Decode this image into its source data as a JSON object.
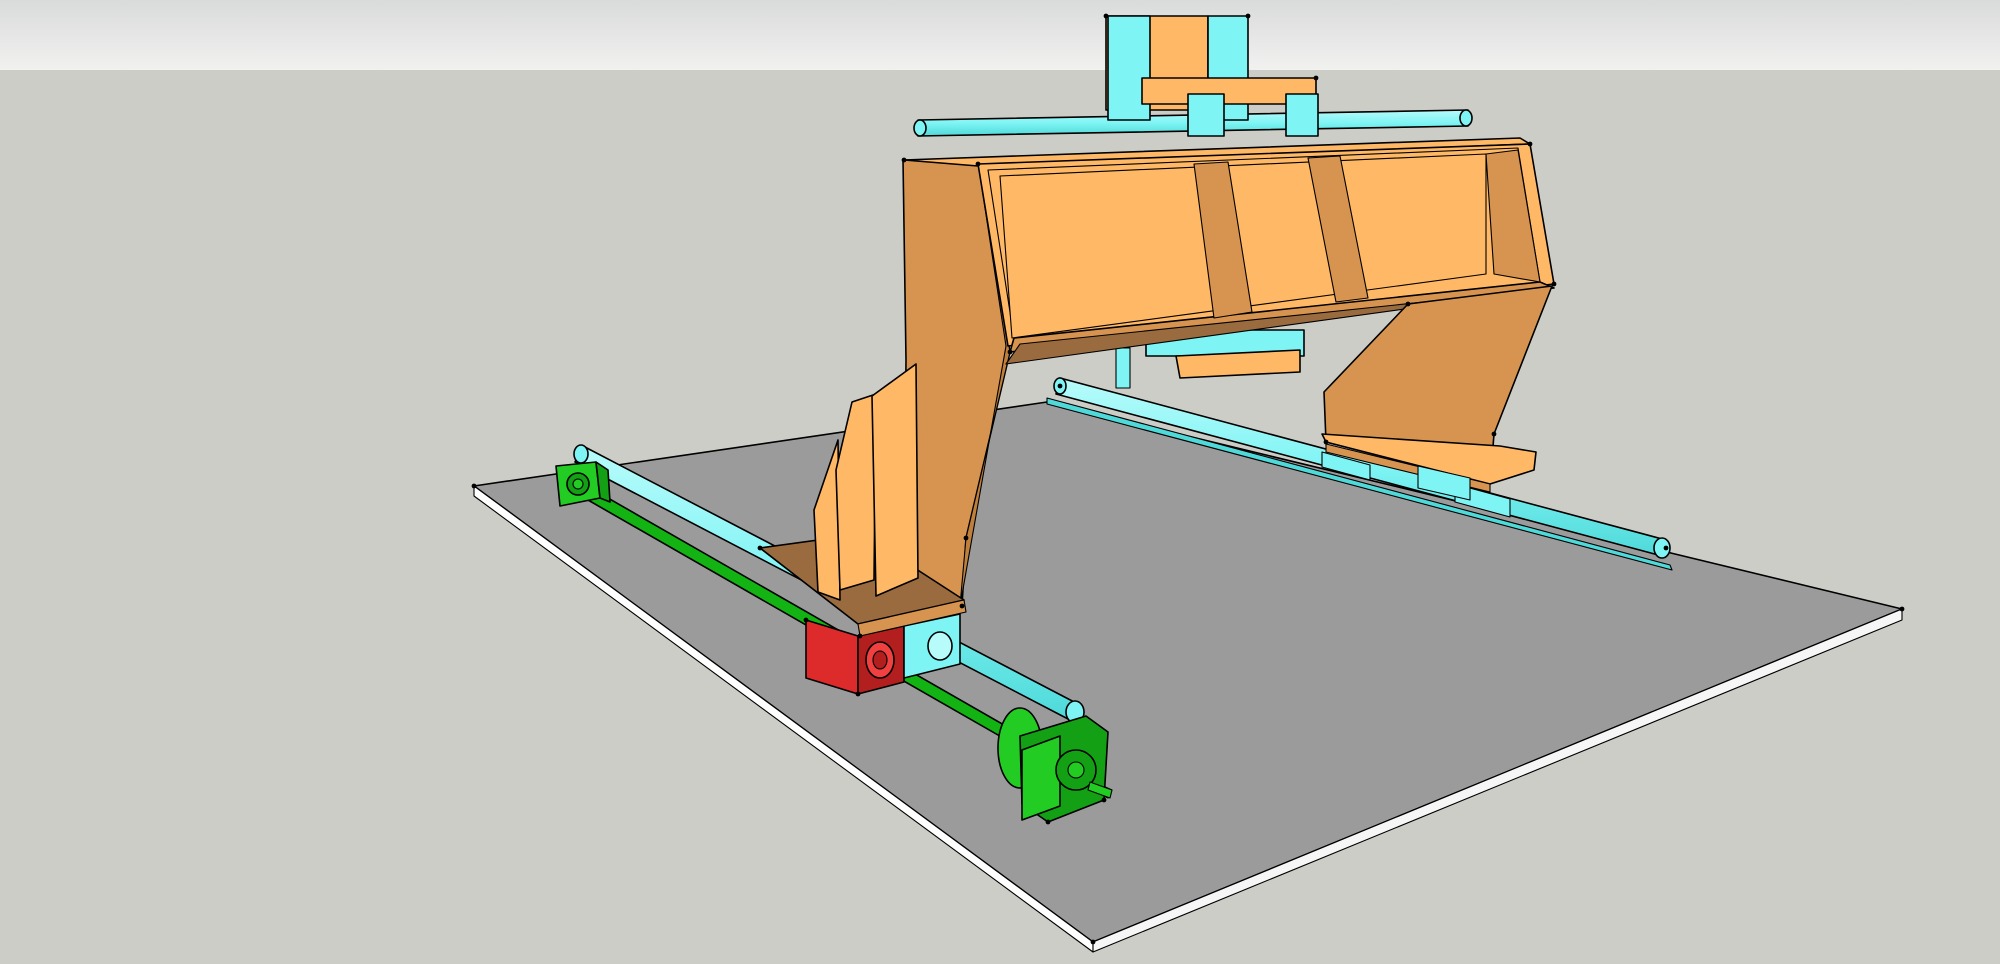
{
  "viewport": {
    "sky_color": "#e6e7e6",
    "ground_color": "#cdcdc8",
    "style": "hidden-line sketch with endpoint markers"
  },
  "scene": {
    "subject": "cnc-gantry-machine",
    "parts": [
      {
        "name": "base-plate",
        "color": "#9b9b9b",
        "edge_color": "#ffffff"
      },
      {
        "name": "gantry-frame",
        "color": "#ffb866",
        "shade_color": "#d69450",
        "material": "wood"
      },
      {
        "name": "linear-rails",
        "color": "#7ff4f4",
        "material": "steel"
      },
      {
        "name": "lead-screw",
        "color": "#12b312",
        "material": "steel"
      },
      {
        "name": "stepper-motors",
        "color": "#22cc22"
      },
      {
        "name": "lead-screw-nut-block",
        "color": "#dd2a2a"
      },
      {
        "name": "spindle",
        "color": "#7ff4f4"
      }
    ]
  }
}
